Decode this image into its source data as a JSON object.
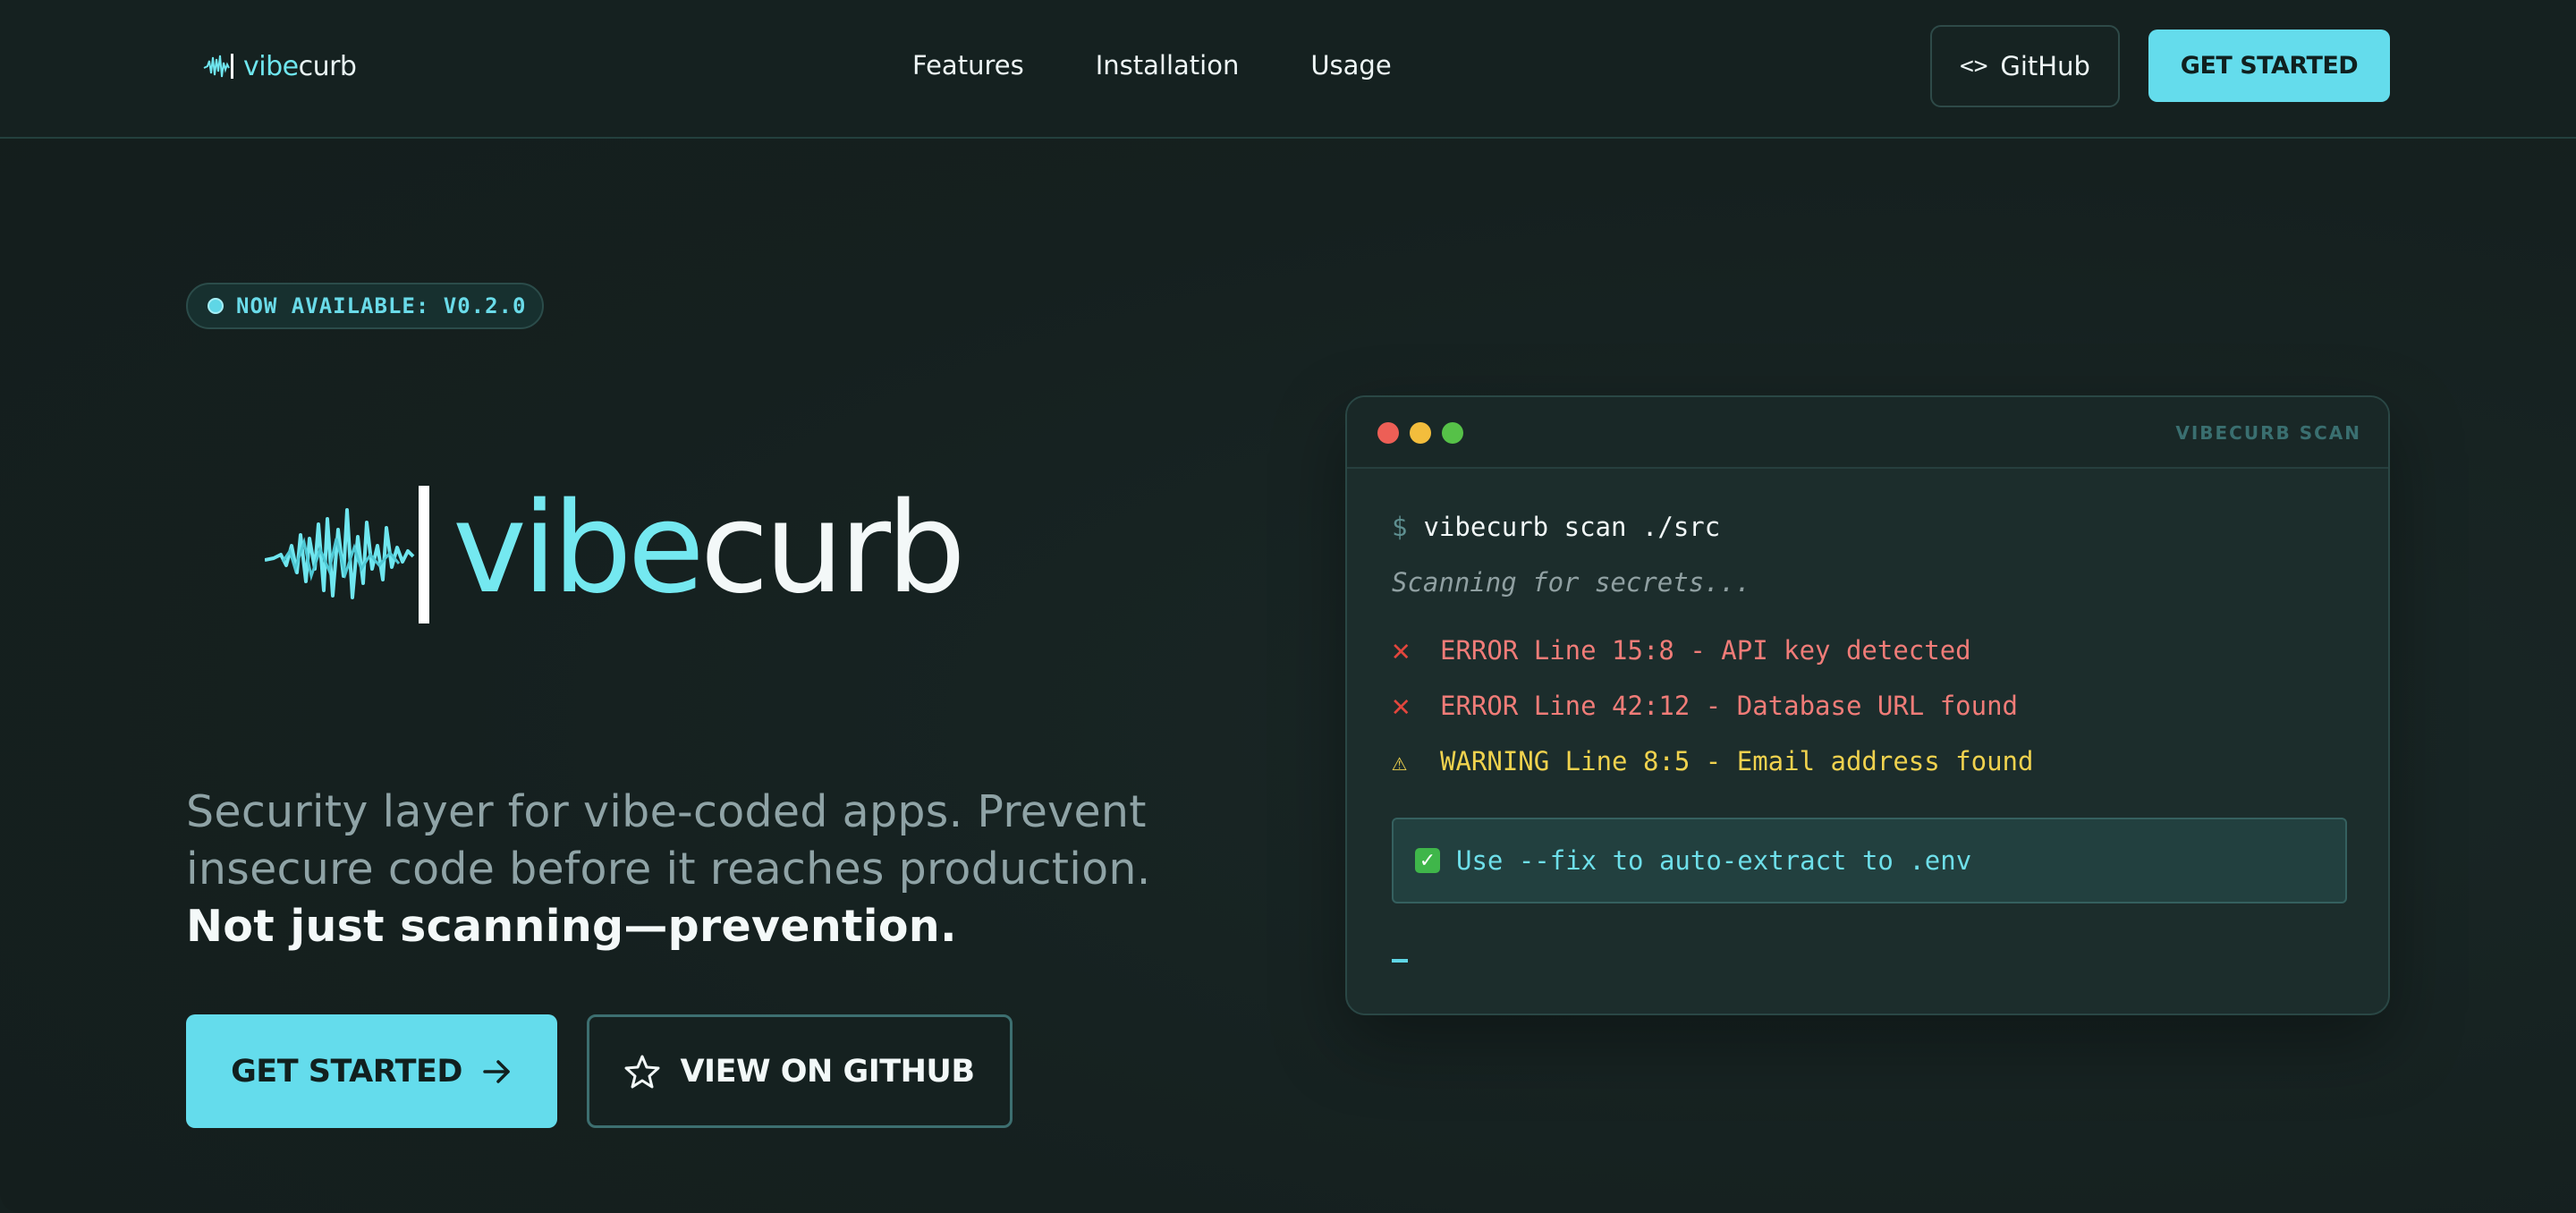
{
  "brand": {
    "name_part1": "vibe",
    "name_part2": "curb"
  },
  "nav": {
    "links": [
      "Features",
      "Installation",
      "Usage"
    ],
    "github_label": "GitHub",
    "github_icon": "code-icon",
    "start_label": "GET STARTED"
  },
  "hero": {
    "badge": "NOW AVAILABLE: V0.2.0",
    "logo_part1": "vibe",
    "logo_part2": "curb",
    "tagline_regular": "Security layer for vibe-coded apps. Prevent insecure code before it reaches production.",
    "tagline_bold": "Not just scanning—prevention.",
    "cta_start": "GET STARTED",
    "cta_github": "VIEW ON GITHUB"
  },
  "terminal": {
    "title": "VIBECURB SCAN",
    "prompt": "$",
    "command": "vibecurb scan ./src",
    "scanning": "Scanning for secrets...",
    "lines": [
      {
        "type": "error",
        "text": "ERROR Line 15:8 - API key detected"
      },
      {
        "type": "error",
        "text": "ERROR Line 42:12 - Database URL found"
      },
      {
        "type": "warning",
        "text": "WARNING Line 8:5 - Email address found"
      }
    ],
    "fix": "Use --fix to auto-extract to .env"
  },
  "colors": {
    "accent": "#64dcec",
    "background": "#15201f",
    "error": "#f07c78",
    "warning": "#f0d24e",
    "dot_red": "#ed5f56",
    "dot_yellow": "#f3bd3c",
    "dot_green": "#56c148"
  }
}
